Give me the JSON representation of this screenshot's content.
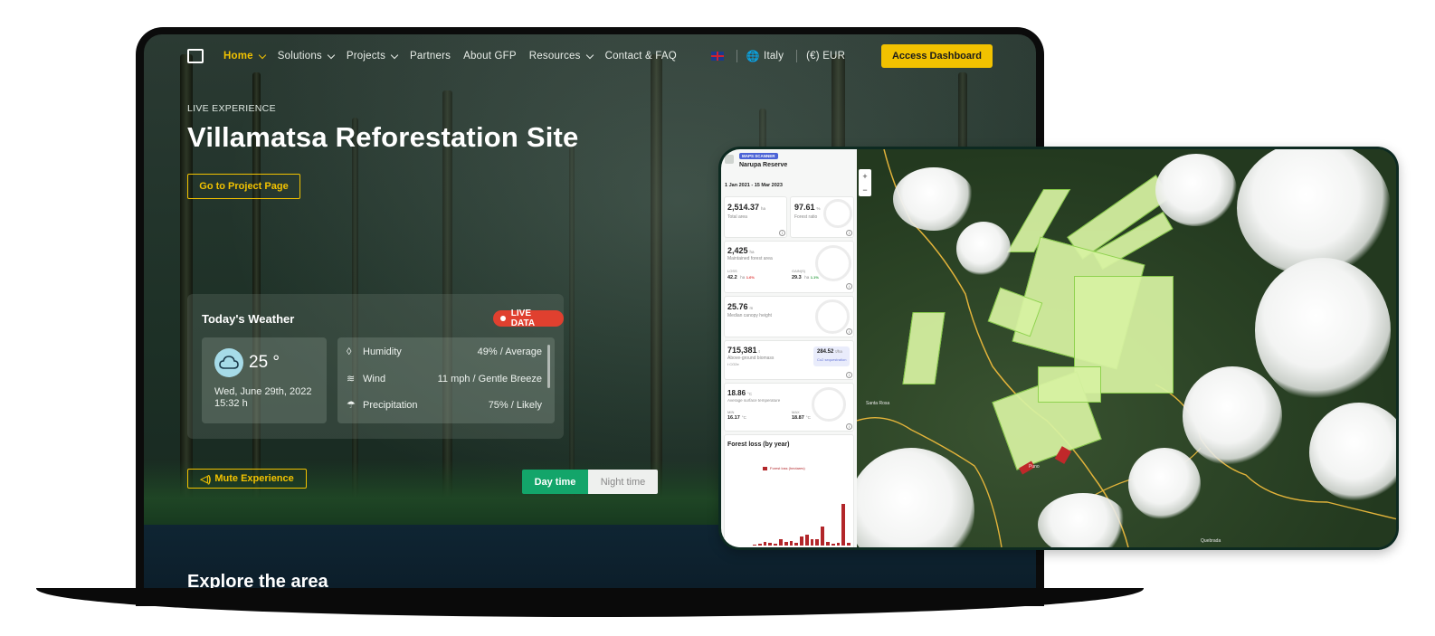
{
  "nav": {
    "logo_icon": "logo-mark-icon",
    "items": [
      {
        "label": "Home",
        "active": true,
        "dropdown": true
      },
      {
        "label": "Solutions",
        "active": false,
        "dropdown": true
      },
      {
        "label": "Projects",
        "active": false,
        "dropdown": true
      },
      {
        "label": "Partners",
        "active": false,
        "dropdown": false
      },
      {
        "label": "About GFP",
        "active": false,
        "dropdown": false
      },
      {
        "label": "Resources",
        "active": false,
        "dropdown": true
      },
      {
        "label": "Contact & FAQ",
        "active": false,
        "dropdown": false
      }
    ],
    "country": "Italy",
    "currency": "(€) EUR",
    "cta": "Access Dashboard"
  },
  "hero": {
    "eyebrow": "LIVE EXPERIENCE",
    "title": "Villamatsa Reforestation Site",
    "project_button": "Go to Project Page",
    "mute_button": "Mute Experience"
  },
  "weather": {
    "title": "Today's Weather",
    "live_badge": "LIVE DATA",
    "temperature": "25 °",
    "date": "Wed, June 29th, 2022",
    "time": "15:32 h",
    "metrics": [
      {
        "label": "Humidity",
        "value": "49% / Average",
        "icon": "droplet-icon"
      },
      {
        "label": "Wind",
        "value": "11 mph / Gentle Breeze",
        "icon": "wind-icon"
      },
      {
        "label": "Precipitation",
        "value": "75% / Likely",
        "icon": "rain-cloud-icon"
      }
    ]
  },
  "time_toggle": {
    "day": "Day time",
    "night": "Night time",
    "selected": "day"
  },
  "explore": {
    "title": "Explore the area"
  },
  "dashboard": {
    "badge": "MAPS SCANNER",
    "site_name": "Narupa Reserve",
    "date_range": "1 Jan 2021 - 15 Mar 2023",
    "total_area": {
      "value": "2,514.37",
      "unit": "ha",
      "label": "Total area"
    },
    "forest_ratio": {
      "value": "97.61",
      "unit": "%",
      "label": "Forest ratio"
    },
    "maintained": {
      "value": "2,425",
      "unit": "ha",
      "label": "Maintained forest area",
      "sub1_label": "LOSS",
      "sub1_value": "42.2",
      "sub1_unit": "ha",
      "sub1_change": "1.6%",
      "sub2_label": "GAIN(S)",
      "sub2_value": "29.3",
      "sub2_unit": "ha",
      "sub2_change": "1.1%"
    },
    "canopy": {
      "value": "25.76",
      "unit": "m",
      "label": "Median canopy height"
    },
    "biomass": {
      "value": "715,381",
      "unit": "t",
      "label": "Above-ground biomass",
      "sub": "t CO2e",
      "chip_value": "284.52",
      "chip_unit": "t/ha",
      "chip_label": "Co2 sequestration"
    },
    "temperature": {
      "value": "18.86",
      "unit": "°C",
      "label": "Average surface temperature",
      "min_label": "MIN",
      "min_value": "16.17",
      "max_label": "MAX",
      "max_value": "18.87",
      "deg": "°C"
    },
    "forest_loss": {
      "title": "Forest loss (by year)",
      "legend": "Forest loss (hectares)"
    },
    "zoom_in": "+",
    "zoom_out": "−",
    "map_labels": [
      "Santa Rosa",
      "Puno",
      "Quebrada"
    ]
  },
  "chart_data": {
    "type": "bar",
    "title": "Forest loss (by year)",
    "legend": "Forest loss (hectares)",
    "values": [
      0.02,
      0.03,
      0.06,
      0.04,
      0.03,
      0.1,
      0.05,
      0.07,
      0.04,
      0.13,
      0.16,
      0.09,
      0.1,
      0.28,
      0.06,
      0.03,
      0.04,
      0.62,
      0.04
    ]
  },
  "colors": {
    "accent": "#f2c200",
    "live": "#e0402f",
    "toggle_on": "#13a56a",
    "loss_bar": "#b2262a",
    "field": "#d7f2a2"
  }
}
